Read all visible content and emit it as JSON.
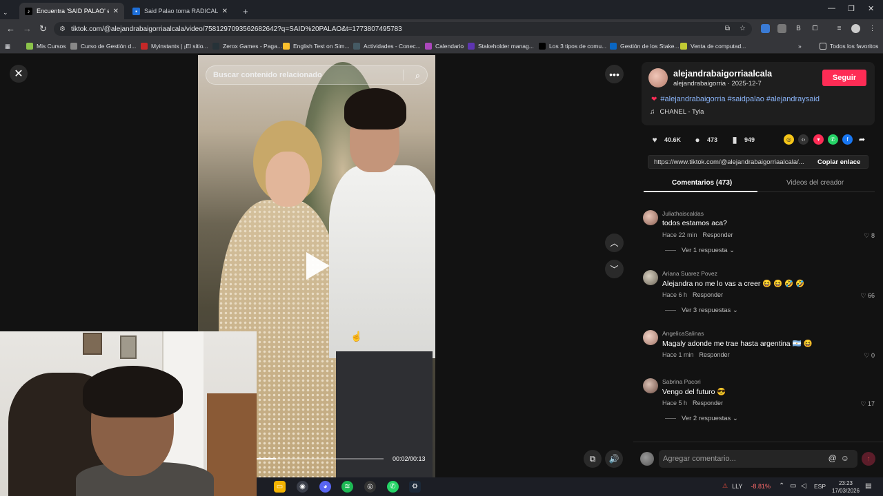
{
  "browser": {
    "tabs": [
      {
        "title": "Encuentra 'SAID PALAO' en TikT",
        "active": true
      },
      {
        "title": "Said Palao toma RADICAL decis",
        "active": false
      }
    ],
    "url": "tiktok.com/@alejandrabaigorriaalcala/video/7581297093562682642?q=SAID%20PALAO&t=1773807495783",
    "bookmarks": [
      "Mis Cursos",
      "Curso de Gestión d...",
      "Myinstants | ¡El sitio...",
      "Zerox Games - Paga...",
      "English Test on Sim...",
      "Actividades - Conec...",
      "Calendario",
      "Stakeholder manag...",
      "Los 3 tipos de comu...",
      "Gestión de los Stake...",
      "Venta de computad..."
    ],
    "all_bookmarks": "Todos los favoritos"
  },
  "video": {
    "search_placeholder": "Buscar contenido relacionado",
    "time": "00:02/00:13",
    "progress_fraction": 0.15
  },
  "author": {
    "display_name": "alejandrabaigorriaalcala",
    "handle": "alejandrabaigorria",
    "date": "2025-12-7",
    "follow_label": "Seguir",
    "hashtags": "#alejandrabaigorria #saidpalao #alejandraysaid",
    "music": "CHANEL - Tyla"
  },
  "stats": {
    "likes": "40.6K",
    "comments": "473",
    "saves": "949"
  },
  "link": {
    "url": "https://www.tiktok.com/@alejandrabaigorriaalcala/...",
    "copy_label": "Copiar enlace"
  },
  "tabs": {
    "comments": "Comentarios (473)",
    "creator_videos": "Videos del creador"
  },
  "comments": [
    {
      "user": "Juliathaiscaldas",
      "text": "todos estamos aca?",
      "time": "Hace 22 min",
      "reply": "Responder",
      "likes": "8",
      "replies": "Ver 1 respuesta"
    },
    {
      "user": "Ariana Suarez Povez",
      "text": "Alejandra no me lo vas a creer 😆 😆 🤣 🤣",
      "time": "Hace 6 h",
      "reply": "Responder",
      "likes": "66",
      "replies": "Ver 3 respuestas"
    },
    {
      "user": "AngelicaSalinas",
      "text": "Magaly adonde me trae hasta argentina 🇦🇷 😆",
      "time": "Hace 1 min",
      "reply": "Responder",
      "likes": "0",
      "replies": ""
    },
    {
      "user": "Sabrina Pacori",
      "text": "Vengo del futuro 😎",
      "time": "Hace 5 h",
      "reply": "Responder",
      "likes": "17",
      "replies": "Ver 2 respuestas"
    }
  ],
  "comment_input": {
    "placeholder": "Agregar comentario..."
  },
  "taskbar": {
    "stock_name": "LLY",
    "stock_change": "-8.81%",
    "lang": "ESP",
    "time": "23:23",
    "date": "17/03/2026"
  },
  "colors": {
    "accent": "#fe2c55",
    "link": "#8ab4f8"
  }
}
